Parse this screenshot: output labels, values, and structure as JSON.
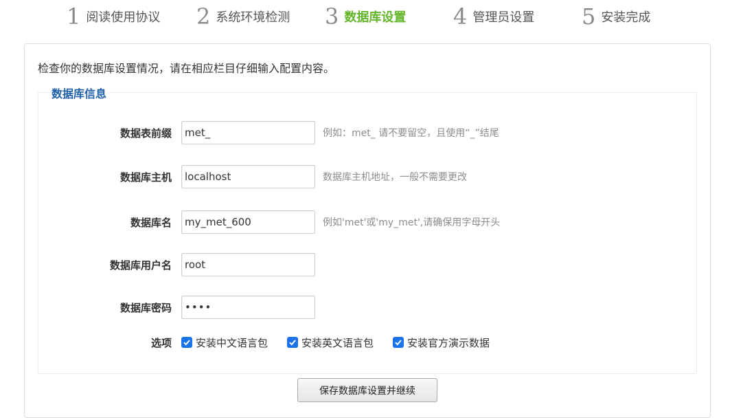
{
  "steps": [
    {
      "num": "1",
      "label": "阅读使用协议",
      "active": false
    },
    {
      "num": "2",
      "label": "系统环境检测",
      "active": false
    },
    {
      "num": "3",
      "label": "数据库设置",
      "active": true
    },
    {
      "num": "4",
      "label": "管理员设置",
      "active": false
    },
    {
      "num": "5",
      "label": "安装完成",
      "active": false
    }
  ],
  "intro": "检查你的数据库设置情况，请在相应栏目仔细输入配置内容。",
  "legend": "数据库信息",
  "fields": {
    "prefix": {
      "label": "数据表前缀",
      "value": "met_",
      "hint": "例如：met_ 请不要留空，且使用“_”结尾"
    },
    "host": {
      "label": "数据库主机",
      "value": "localhost",
      "hint": "数据库主机地址，一般不需要更改"
    },
    "name": {
      "label": "数据库名",
      "value": "my_met_600",
      "hint": "例如'met'或'my_met',请确保用字母开头"
    },
    "user": {
      "label": "数据库用户名",
      "value": "root",
      "hint": ""
    },
    "password": {
      "label": "数据库密码",
      "value": "••••",
      "hint": ""
    }
  },
  "options": {
    "label": "选项",
    "items": [
      {
        "label": "安装中文语言包",
        "checked": true
      },
      {
        "label": "安装英文语言包",
        "checked": true
      },
      {
        "label": "安装官方演示数据",
        "checked": true
      }
    ]
  },
  "save_button": "保存数据库设置并继续",
  "colors": {
    "active_step": "#63b52a",
    "legend": "#1f5fa8",
    "checkbox": "#1a73e8"
  }
}
